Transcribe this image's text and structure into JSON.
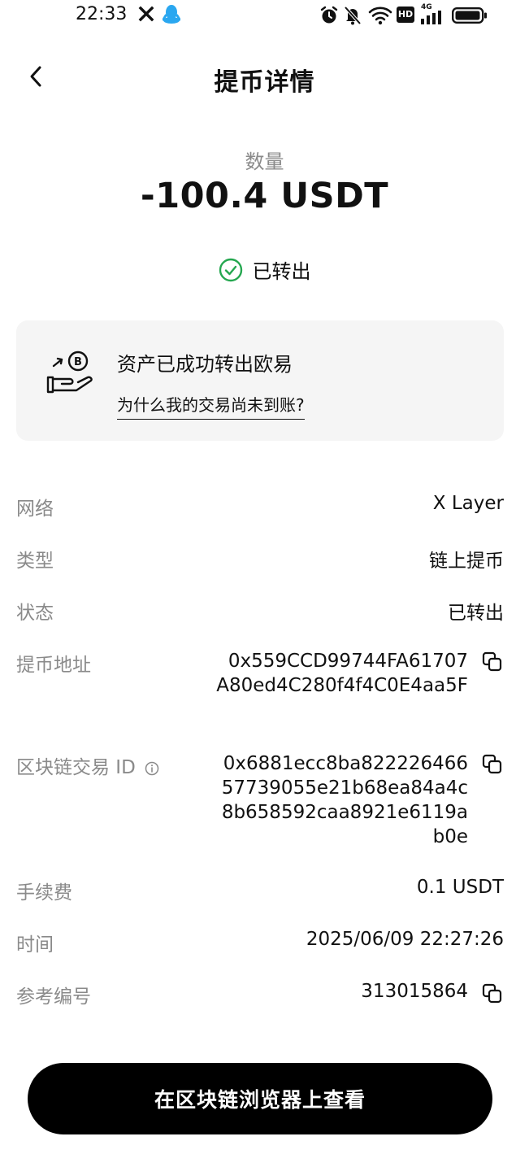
{
  "status_bar": {
    "time": "22:33",
    "left_icons": [
      "x-icon",
      "qq-icon"
    ],
    "right_icons": [
      "alarm-icon",
      "mute-icon",
      "wifi-icon",
      "hd-icon",
      "signal-4g-icon",
      "battery-icon"
    ],
    "network_type": "4G",
    "hd_label": "HD"
  },
  "nav": {
    "back_icon": "chevron-left-icon",
    "title": "提币详情"
  },
  "summary": {
    "amount_label": "数量",
    "amount_value": "-100.4 USDT",
    "status_icon": "check-circle-icon",
    "status_text": "已转出",
    "status_color": "#25a750"
  },
  "info_card": {
    "icon": "hand-coin-icon",
    "title": "资产已成功转出欧易",
    "link": "为什么我的交易尚未到账?"
  },
  "details": {
    "network": {
      "label": "网络",
      "value": "X Layer"
    },
    "type": {
      "label": "类型",
      "value": "链上提币"
    },
    "status": {
      "label": "状态",
      "value": "已转出"
    },
    "address": {
      "label": "提币地址",
      "value": "0x559CCD99744FA61707A80ed4C280f4f4C0E4aa5F"
    },
    "tx_id": {
      "label": "区块链交易 ID",
      "value": "0x6881ecc8ba82222646657739055e21b68ea84a4c8b658592caa8921e6119ab0e"
    },
    "fee": {
      "label": "手续费",
      "value": "0.1 USDT"
    },
    "time": {
      "label": "时间",
      "value": "2025/06/09 22:27:26"
    },
    "reference": {
      "label": "参考编号",
      "value": "313015864"
    }
  },
  "footer": {
    "explorer_button": "在区块链浏览器上查看"
  }
}
